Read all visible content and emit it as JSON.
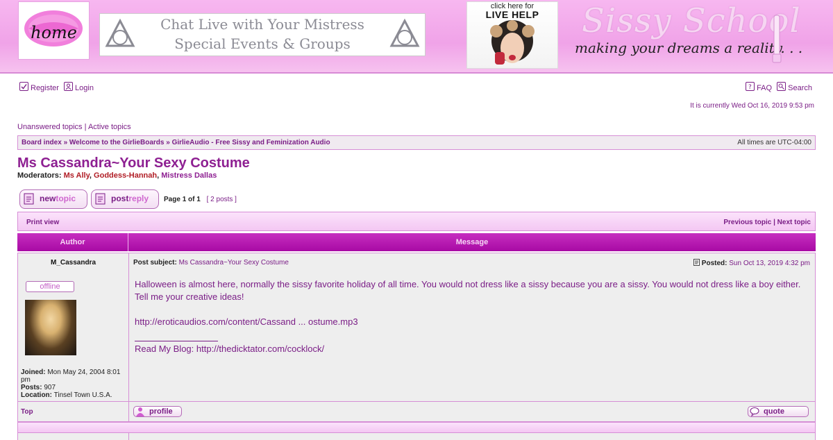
{
  "header": {
    "home_label": "home",
    "chat_banner": {
      "line1": "Chat Live with Your Mistress",
      "line2": "Special Events & Groups"
    },
    "live_help": {
      "line1": "click here for",
      "line2": "LIVE HELP"
    },
    "site_title": "Sissy School",
    "site_tagline": "making your dreams a reality. . ."
  },
  "nav": {
    "register": "Register",
    "login": "Login",
    "faq": "FAQ",
    "search": "Search"
  },
  "current_time": "It is currently Wed Oct 16, 2019 9:53 pm",
  "quicklinks": {
    "unanswered": "Unanswered topics",
    "separator": "|",
    "active": "Active topics"
  },
  "breadcrumb": {
    "items": [
      "Board index",
      "Welcome to the GirlieBoards",
      "GirlieAudio - Free Sissy and Feminization Audio"
    ],
    "separator": "»",
    "timezone": "All times are UTC-04:00"
  },
  "topic": {
    "title": "Ms Cassandra~Your Sexy Costume",
    "moderators_label": "Moderators:",
    "moderators": [
      "Ms Ally",
      "Goddess-Hannah",
      "Mistress Dallas"
    ]
  },
  "buttons": {
    "new_topic": {
      "a": "new",
      "b": "topic"
    },
    "post_reply": {
      "a": "post",
      "b": "reply"
    }
  },
  "pagination": {
    "page_label": "Page",
    "current": "1",
    "of": "of",
    "total": "1",
    "posts": "[ 2 posts ]"
  },
  "table": {
    "print_view": "Print view",
    "previous_topic": "Previous topic",
    "nav_separator": "|",
    "next_topic": "Next topic",
    "col_author": "Author",
    "col_message": "Message"
  },
  "post": {
    "author": "M_Cassandra",
    "subject_label": "Post subject:",
    "subject": "Ms Cassandra~Your Sexy Costume",
    "posted_label": "Posted:",
    "posted": "Sun Oct 13, 2019 4:32 pm",
    "status": "offline",
    "joined_label": "Joined:",
    "joined": "Mon May 24, 2004 8:01 pm",
    "posts_label": "Posts:",
    "posts": "907",
    "location_label": "Location:",
    "location": "Tinsel Town U.S.A.",
    "body": "Halloween is almost here, normally the sissy favorite holiday of all time. You would not dress like a sissy because you are a sissy. You would not dress like a boy either. Tell me your creative ideas!",
    "link": "http://eroticaudios.com/content/Cassand ... ostume.mp3",
    "signature_label": "Read My Blog:",
    "signature_link": "http://thedicktator.com/cocklock/",
    "top_link": "Top",
    "profile_btn": "profile",
    "quote_btn": "quote"
  },
  "colors": {
    "accent_purple": "#7a1d86",
    "header_pink": "#f0a3e8",
    "table_header": "#b81bb3",
    "row_bg": "#eeeeee"
  }
}
